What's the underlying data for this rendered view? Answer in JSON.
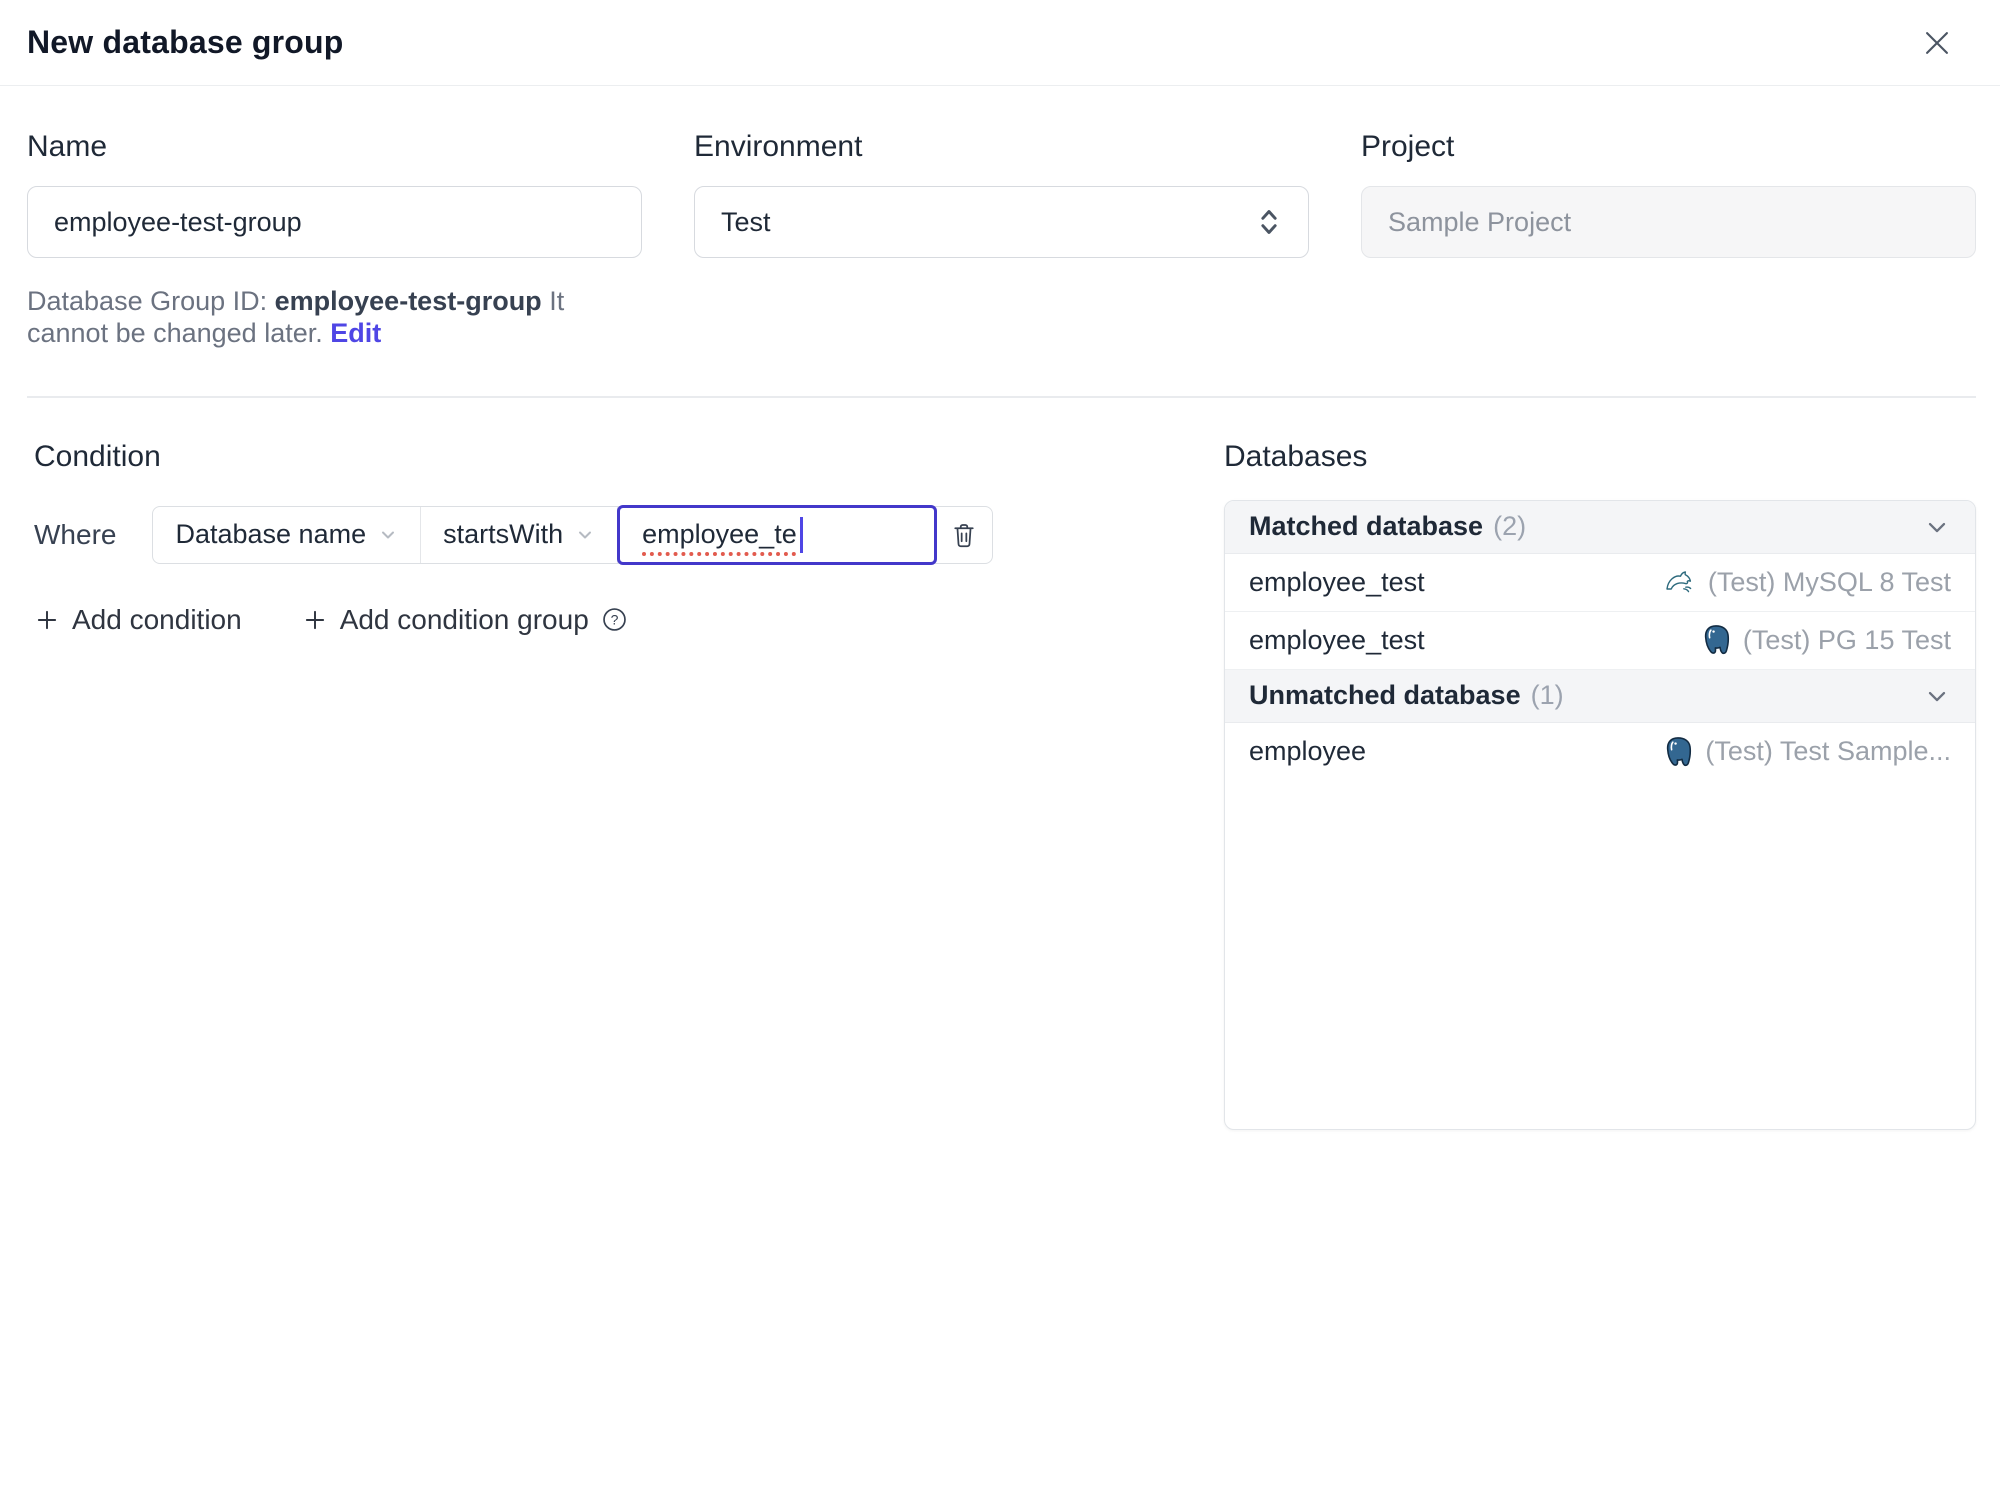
{
  "dialog": {
    "title": "New database group"
  },
  "form": {
    "name": {
      "label": "Name",
      "value": "employee-test-group"
    },
    "helper": {
      "prefix": "Database Group ID: ",
      "id": "employee-test-group",
      "suffix": " It cannot be changed later. ",
      "edit_label": "Edit"
    },
    "environment": {
      "label": "Environment",
      "value": "Test"
    },
    "project": {
      "label": "Project",
      "value": "Sample Project"
    }
  },
  "condition": {
    "heading": "Condition",
    "where_label": "Where",
    "field_selected": "Database name",
    "operator_selected": "startsWith",
    "value": "employee_te",
    "add_condition_label": "Add condition",
    "add_condition_group_label": "Add condition group"
  },
  "databases": {
    "heading": "Databases",
    "groups": [
      {
        "title": "Matched database",
        "count": "(2)",
        "rows": [
          {
            "name": "employee_test",
            "engine": "mysql",
            "instance": "(Test) MySQL 8 Test"
          },
          {
            "name": "employee_test",
            "engine": "postgres",
            "instance": "(Test) PG 15 Test"
          }
        ]
      },
      {
        "title": "Unmatched database",
        "count": "(1)",
        "rows": [
          {
            "name": "employee",
            "engine": "postgres",
            "instance": "(Test) Test Sample..."
          }
        ]
      }
    ]
  },
  "icons": {
    "close": "x-cross",
    "select_chevron": "chevron-down",
    "env_select": "chevrons-up-down",
    "trash": "trash-can",
    "plus": "plus",
    "help": "question-circle",
    "panel_collapse": "chevron-down",
    "mysql": "mysql-dolphin",
    "postgres": "postgres-elephant"
  },
  "colors": {
    "focus_border": "#4338ca",
    "edit_link": "#4f46e5",
    "caret": "#4f46e5",
    "spellcheck_underline": "#e25b4e",
    "secondary_text": "#9ba1aa",
    "header_bg": "#f4f5f7",
    "mysql_teal": "#2d6a7d",
    "postgres_blue": "#336791"
  }
}
